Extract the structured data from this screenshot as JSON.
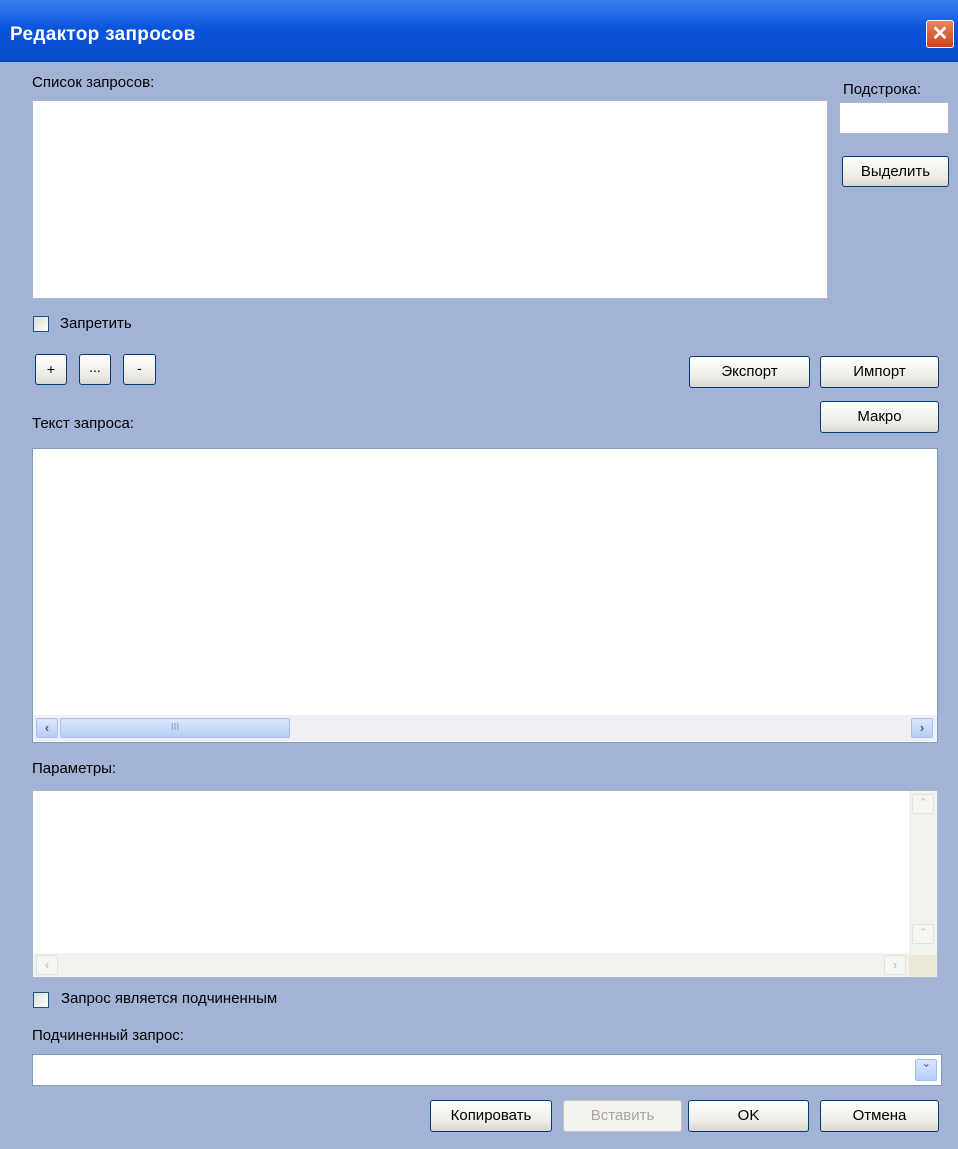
{
  "window": {
    "title": "Редактор запросов",
    "close_glyph": "✕"
  },
  "queries": {
    "label": "Список запросов:",
    "items": []
  },
  "substring": {
    "label": "Подстрока:",
    "value": "",
    "select_label": "Выделить"
  },
  "forbid": {
    "label": "Запретить",
    "checked": false
  },
  "list_buttons": {
    "add": "+",
    "edit": "...",
    "remove": "-"
  },
  "io_buttons": {
    "export": "Экспорт",
    "import": "Импорт",
    "macro": "Макро"
  },
  "query_text": {
    "label": "Текст запроса:",
    "value": "",
    "hscroll_grip": "III"
  },
  "params": {
    "label": "Параметры:",
    "value": ""
  },
  "subordinate_flag": {
    "label": "Запрос является подчиненным",
    "checked": false
  },
  "subordinate_query": {
    "label": "Подчиненный запрос:",
    "selected": ""
  },
  "footer": {
    "copy": "Копировать",
    "paste": "Вставить",
    "ok": "OK",
    "cancel": "Отмена"
  },
  "icons": {
    "left_arrow": "chevron-left-icon",
    "right_arrow": "chevron-right-icon",
    "up_arrow": "chevron-up-icon",
    "down_arrow": "chevron-down-icon"
  },
  "colors": {
    "dialog_bg": "#a3b3d6",
    "title_blue": "#0a55dd",
    "close_red": "#d34b1f"
  }
}
